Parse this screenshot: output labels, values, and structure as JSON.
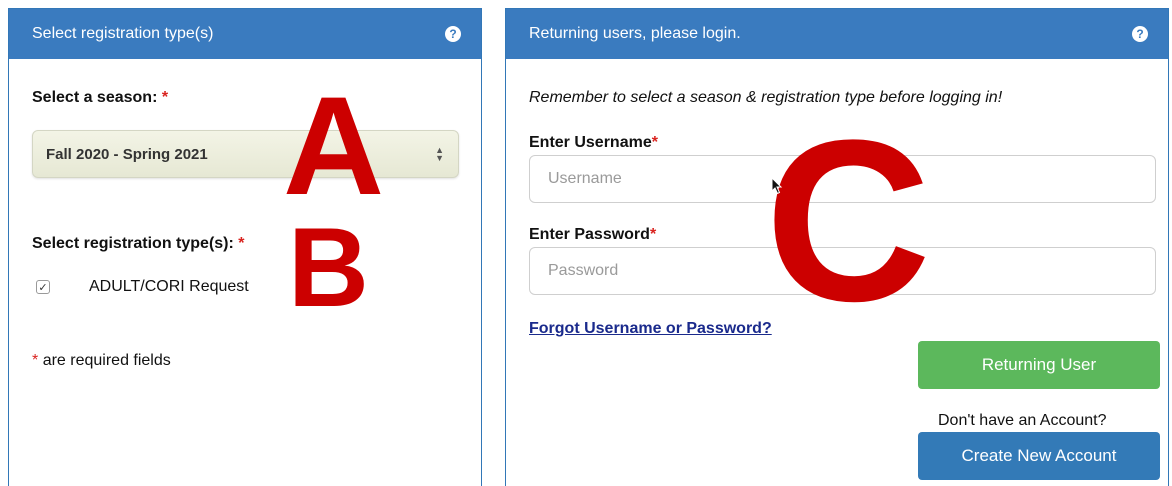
{
  "left_panel": {
    "title": "Select registration type(s)",
    "help_icon": "question-circle-icon",
    "season_label": "Select a season:",
    "season_selected": "Fall 2020 - Spring 2021",
    "regtype_label": "Select registration type(s):",
    "regtype_option": "ADULT/CORI Request",
    "regtype_checked": true,
    "required_note": "are required fields",
    "required_marker": "*"
  },
  "right_panel": {
    "title": "Returning users, please login.",
    "help_icon": "question-circle-icon",
    "reminder": "Remember to select a season & registration type before logging in!",
    "username_label": "Enter Username",
    "username_placeholder": "Username",
    "password_label": "Enter Password",
    "password_placeholder": "Password",
    "forgot_link": "Forgot Username or Password?",
    "returning_button": "Returning User",
    "no_account_text": "Don't have an Account?",
    "create_button": "Create New Account"
  },
  "annotations": {
    "letter_a": "A",
    "letter_b": "B",
    "letter_c": "C",
    "color": "#cc0000"
  },
  "colors": {
    "header_blue": "#3a7bbf",
    "required_red": "#d9231f",
    "button_green": "#5cb85c",
    "button_blue": "#337ab7",
    "link_blue": "#1a2a8c"
  }
}
